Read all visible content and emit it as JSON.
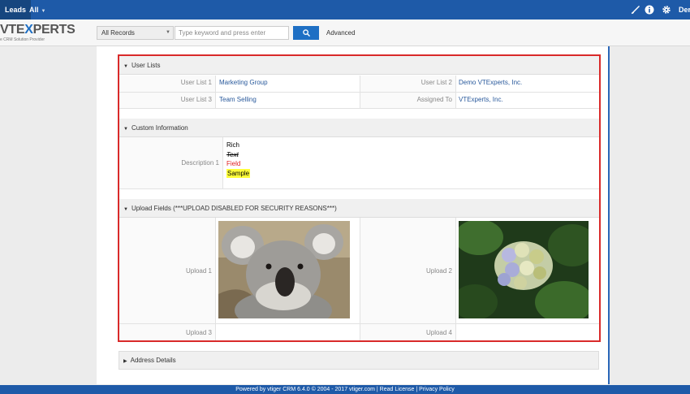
{
  "topbar": {
    "module": "Leads",
    "filter": "All",
    "user": "Der",
    "icons": [
      "brush-icon",
      "info-icon",
      "gear-icon"
    ]
  },
  "search": {
    "logo_text_1": "VTE",
    "logo_text_x": "X",
    "logo_text_2": "PERTS",
    "logo_tagline": "e   CRM Solution Provider",
    "scope": "All Records",
    "placeholder": "Type keyword and press enter",
    "advanced": "Advanced"
  },
  "user_lists": {
    "title": "User Lists",
    "rows": [
      {
        "l1": "User List 1",
        "v1": "Marketing Group",
        "l2": "User List 2",
        "v2": "Demo VTExperts, Inc."
      },
      {
        "l1": "User List 3",
        "v1": "Team Selling",
        "l2": "Assigned To",
        "v2": "VTExperts, Inc."
      }
    ]
  },
  "custom_info": {
    "title": "Custom Information",
    "label": "Description 1",
    "lines": {
      "rich": "Rich",
      "text": "Text",
      "field": "Field",
      "sample": "Sample"
    }
  },
  "upload_fields": {
    "title": "Upload Fields (***UPLOAD DISABLED FOR SECURITY REASONS***)",
    "upload1": "Upload 1",
    "upload2": "Upload 2",
    "upload3": "Upload 3",
    "upload4": "Upload 4"
  },
  "address_details": {
    "title": "Address Details"
  },
  "footer": {
    "text": "Powered by vtiger CRM 6.4.0  © 2004 - 2017  vtiger.com | Read License | Privacy Policy"
  },
  "colors": {
    "topbar": "#1e5aa8",
    "accent": "#1e6fc4",
    "highlight_border": "#d92a2a",
    "link": "#2a5a9c"
  }
}
